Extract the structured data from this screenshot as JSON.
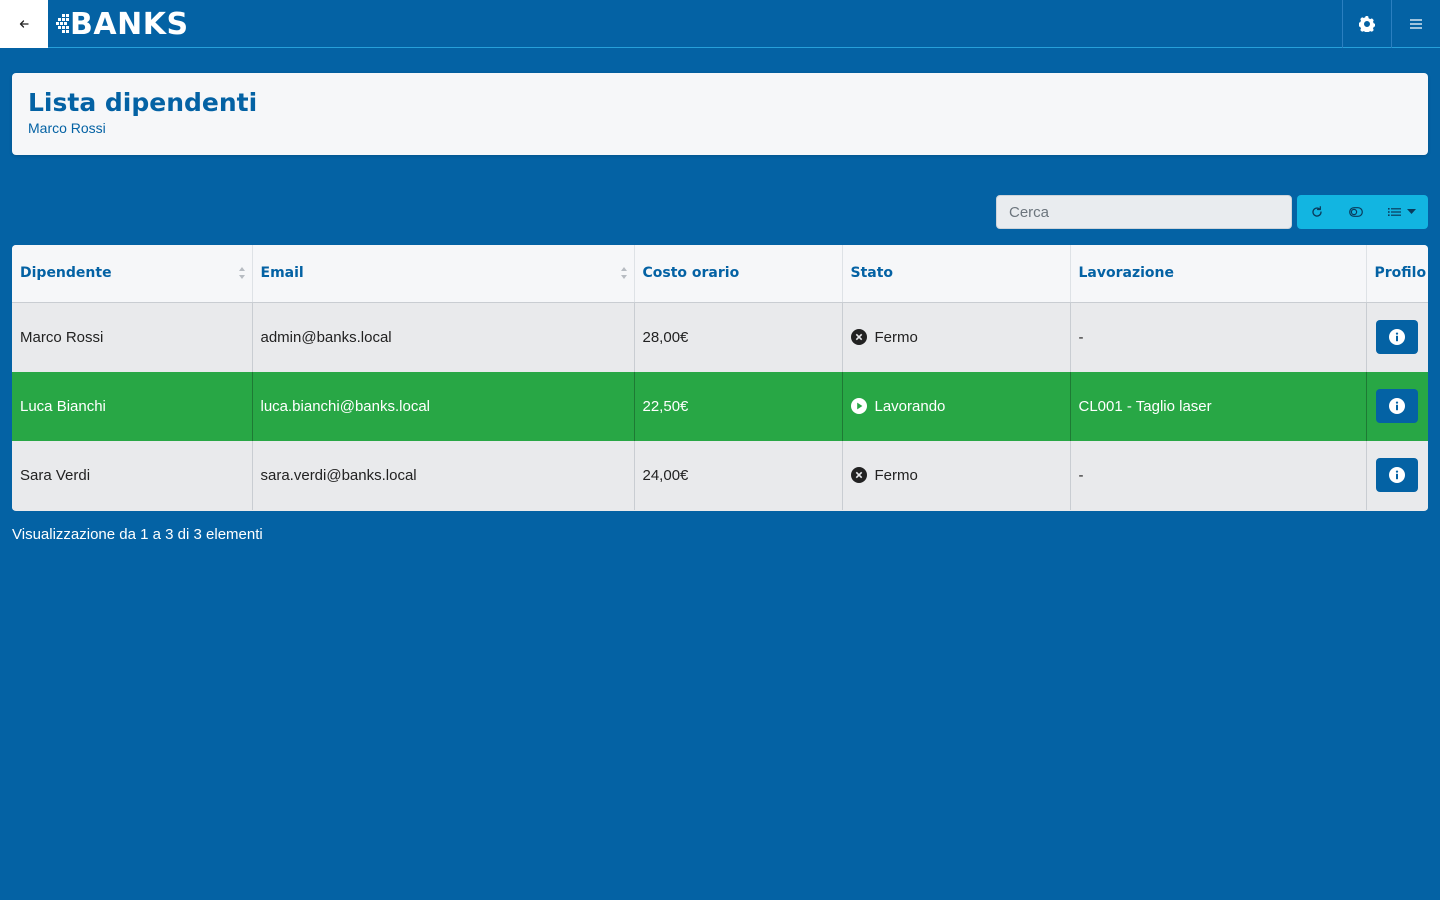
{
  "nav": {
    "back_icon": "arrow-left-icon",
    "logo_text": "BANKS",
    "settings_icon": "gear-icon",
    "menu_icon": "hamburger-menu-icon"
  },
  "header": {
    "title": "Lista dipendenti",
    "subtitle": "Marco Rossi"
  },
  "toolbar": {
    "search_placeholder": "Cerca",
    "refresh_icon": "refresh-icon",
    "toggle_icon": "toggle-icon",
    "columns_icon": "list-columns-icon"
  },
  "table": {
    "headers": [
      "Dipendente",
      "Email",
      "Costo orario",
      "Stato",
      "Lavorazione",
      "Profilo"
    ],
    "rows": [
      {
        "name": "Marco Rossi",
        "email": "admin@banks.local",
        "cost": "28,00€",
        "status": "Fermo",
        "status_icon": "stop-circle-icon",
        "job": "-",
        "active": false
      },
      {
        "name": "Luca Bianchi",
        "email": "luca.bianchi@banks.local",
        "cost": "22,50€",
        "status": "Lavorando",
        "status_icon": "play-circle-icon",
        "job": "CL001 - Taglio laser",
        "active": true
      },
      {
        "name": "Sara Verdi",
        "email": "sara.verdi@banks.local",
        "cost": "24,00€",
        "status": "Fermo",
        "status_icon": "stop-circle-icon",
        "job": "-",
        "active": false
      }
    ]
  },
  "footer": {
    "info": "Visualizzazione da 1 a 3 di 3 elementi"
  },
  "colors": {
    "primary": "#0462a4",
    "active_row": "#28a745",
    "toolbar_button": "#12b5e1"
  }
}
